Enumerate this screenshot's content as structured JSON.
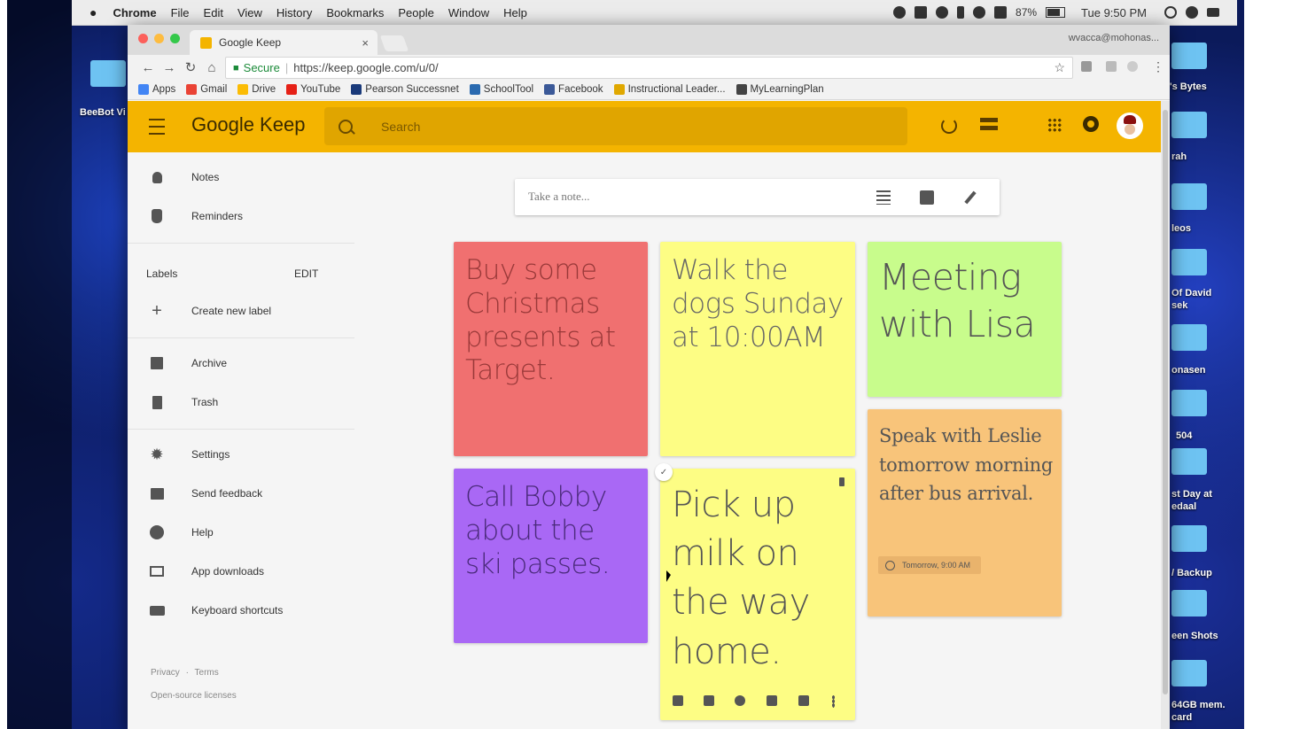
{
  "mac_menubar": {
    "app": "Chrome",
    "items": [
      "File",
      "Edit",
      "View",
      "History",
      "Bookmarks",
      "People",
      "Window",
      "Help"
    ],
    "battery": "87%",
    "clock": "Tue 9:50 PM"
  },
  "desktop": {
    "left_labels": [
      "BeeBot Vi"
    ],
    "right_labels": [
      "'s Bytes",
      "rah",
      "leos",
      "Of David",
      "sek",
      "onasen",
      "504",
      "st Day at",
      "edaal",
      "/ Backup",
      "een Shots",
      "64GB mem.",
      "card"
    ]
  },
  "browser": {
    "tab_title": "Google Keep",
    "tab_close": "×",
    "profile": "wvacca@mohonas...",
    "secure_label": "Secure",
    "url": "https://keep.google.com/u/0/",
    "bookmarks": [
      {
        "label": "Apps",
        "color": "#4285f4"
      },
      {
        "label": "Gmail",
        "color": "#ea4335"
      },
      {
        "label": "Drive",
        "color": "#fbbc05"
      },
      {
        "label": "YouTube",
        "color": "#e62117"
      },
      {
        "label": "Pearson Successnet",
        "color": "#1a3a7a"
      },
      {
        "label": "SchoolTool",
        "color": "#2a6ab0"
      },
      {
        "label": "Facebook",
        "color": "#3b5998"
      },
      {
        "label": "Instructional Leader...",
        "color": "#e0a800"
      },
      {
        "label": "MyLearningPlan",
        "color": "#444"
      }
    ]
  },
  "keep": {
    "brand_color": "#f4b400",
    "title": "Google Keep",
    "search_placeholder": "Search",
    "sidebar": {
      "notes": "Notes",
      "reminders": "Reminders",
      "labels_header": "Labels",
      "edit": "EDIT",
      "create_label": "Create new label",
      "archive": "Archive",
      "trash": "Trash",
      "settings": "Settings",
      "feedback": "Send feedback",
      "help": "Help",
      "app_downloads": "App downloads",
      "keyboard_shortcuts": "Keyboard shortcuts",
      "privacy": "Privacy",
      "dot": "·",
      "terms": "Terms",
      "licenses": "Open-source licenses"
    },
    "take_note_placeholder": "Take a note...",
    "notes": [
      {
        "text": "Buy some Christmas presents at Target.",
        "color": "#f07070"
      },
      {
        "text": "Walk the dogs Sunday at 10:00AM",
        "color": "#fdfd84"
      },
      {
        "text": "Meeting with Lisa",
        "color": "#c8fc8c"
      },
      {
        "text": "Call Bobby about the ski passes.",
        "color": "#a968f5"
      },
      {
        "text": "Pick up milk on the way home.",
        "color": "#fdfd84"
      },
      {
        "text": "Speak with Leslie tomorrow morning after bus arrival.",
        "color": "#f8c47a",
        "reminder": "Tomorrow, 9:00 AM"
      }
    ],
    "check_mark": "✓"
  }
}
